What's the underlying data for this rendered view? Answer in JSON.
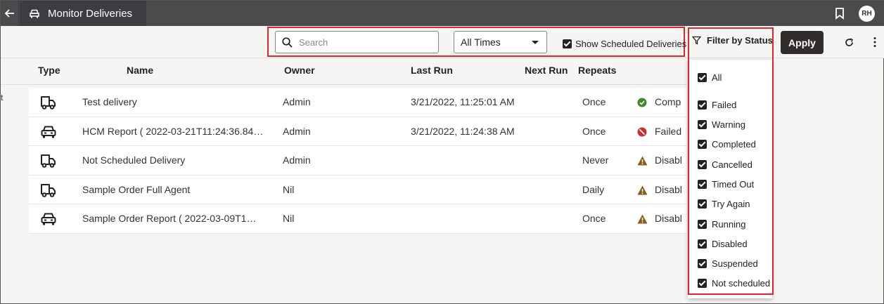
{
  "app": {
    "title": "Monitor Deliveries",
    "avatar_initials": "RH"
  },
  "toolbar": {
    "search_placeholder": "Search",
    "time_filter": "All Times",
    "show_scheduled_label": "Show Scheduled Deliveries",
    "show_scheduled_checked": true,
    "filter_label": "Filter by Status",
    "apply_label": "Apply"
  },
  "table": {
    "headers": {
      "type": "Type",
      "name": "Name",
      "owner": "Owner",
      "last_run": "Last Run",
      "next_run": "Next Run",
      "repeats": "Repeats"
    },
    "rows": [
      {
        "type_icon": "truck-icon",
        "name": "Test delivery",
        "owner": "Admin",
        "last_run": "3/21/2022, 11:25:01 AM",
        "next_run": "",
        "repeats": "Once",
        "status_icon": "success-check-icon",
        "status": "Comp"
      },
      {
        "type_icon": "car-icon",
        "name": "HCM Report ( 2022-03-21T11:24:36.84…",
        "owner": "Admin",
        "last_run": "3/21/2022, 11:24:38 AM",
        "next_run": "",
        "repeats": "Once",
        "status_icon": "failed-icon",
        "status": "Failed"
      },
      {
        "type_icon": "truck-icon",
        "name": "Not Scheduled Delivery",
        "owner": "Admin",
        "last_run": "",
        "next_run": "",
        "repeats": "Never",
        "status_icon": "warning-icon",
        "status": "Disabl"
      },
      {
        "type_icon": "truck-icon",
        "name": "Sample Order Full Agent",
        "owner": "Nil",
        "last_run": "",
        "next_run": "",
        "repeats": "Daily",
        "status_icon": "warning-icon",
        "status": "Disabl"
      },
      {
        "type_icon": "car-icon",
        "name": "Sample Order Report ( 2022-03-09T1…",
        "owner": "Nil",
        "last_run": "",
        "next_run": "",
        "repeats": "Once",
        "status_icon": "warning-icon",
        "status": "Disabl"
      }
    ]
  },
  "status_filter": {
    "items": [
      {
        "label": "All",
        "checked": true
      },
      {
        "label": "Failed",
        "checked": true
      },
      {
        "label": "Warning",
        "checked": true
      },
      {
        "label": "Completed",
        "checked": true
      },
      {
        "label": "Cancelled",
        "checked": true
      },
      {
        "label": "Timed Out",
        "checked": true
      },
      {
        "label": "Try Again",
        "checked": true
      },
      {
        "label": "Running",
        "checked": true
      },
      {
        "label": "Disabled",
        "checked": true
      },
      {
        "label": "Suspended",
        "checked": true
      },
      {
        "label": "Not scheduled",
        "checked": true
      }
    ]
  },
  "colors": {
    "topbar": "#4a4b4d",
    "apply_button": "#312d2a",
    "highlight": "#e0262a",
    "success": "#3e8a2c",
    "failed": "#c8302a",
    "warning": "#8a5a12"
  },
  "edge_text": "t"
}
